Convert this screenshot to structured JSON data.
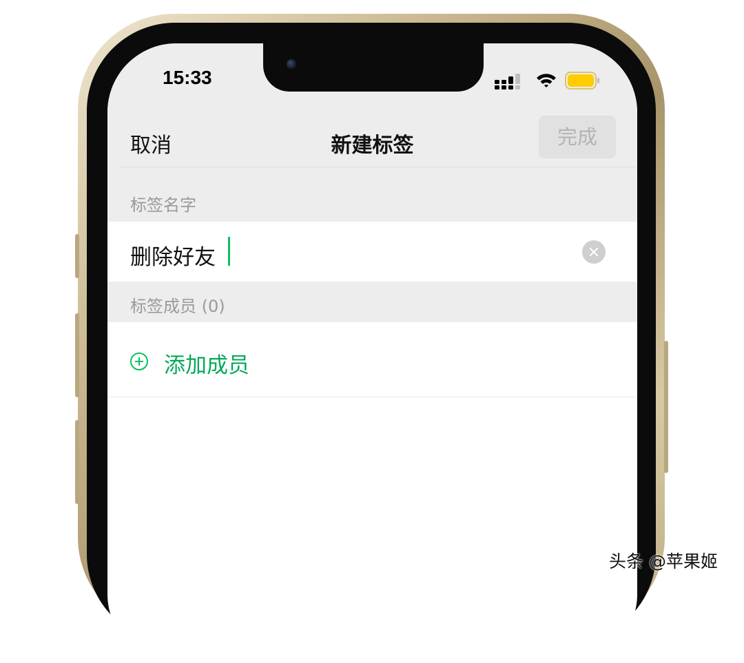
{
  "status_bar": {
    "time": "15:33",
    "icons": [
      "signal-icon",
      "wifi-icon",
      "battery-icon"
    ],
    "battery_color": "#ffcc00"
  },
  "nav": {
    "cancel_label": "取消",
    "title": "新建标签",
    "done_label": "完成"
  },
  "form": {
    "name_section_label": "标签名字",
    "name_value": "删除好友",
    "members_section_label": "标签成员 (0)",
    "add_member_label": "添加成员"
  },
  "watermark": "头条 @苹果姬",
  "colors": {
    "accent": "#07c160",
    "header_bg": "#ededed",
    "disabled_text": "#b4b4b4"
  }
}
